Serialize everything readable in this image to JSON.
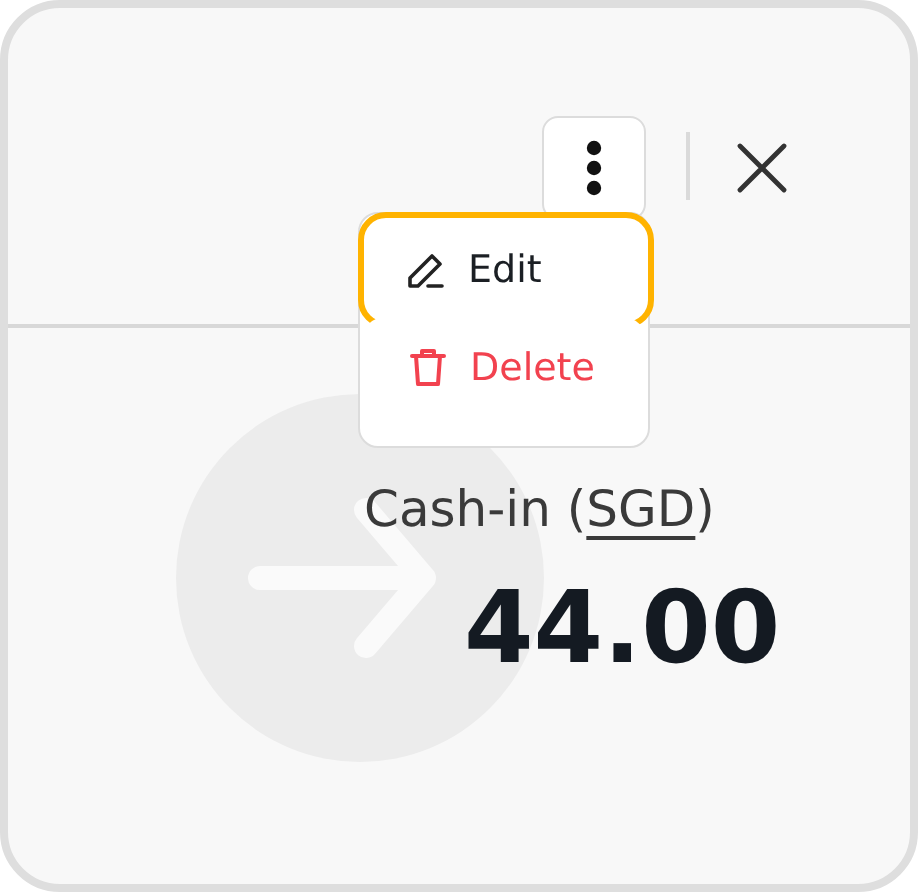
{
  "header": {
    "actions": [
      {
        "kind": "more"
      },
      {
        "kind": "close"
      }
    ]
  },
  "menu": {
    "items": [
      {
        "kind": "edit",
        "label": "Edit",
        "focused": true
      },
      {
        "kind": "delete",
        "label": "Delete",
        "focused": false
      }
    ]
  },
  "transaction": {
    "label_prefix": "Cash-in (",
    "currency": "SGD",
    "label_suffix": ")",
    "amount": "44.00"
  }
}
